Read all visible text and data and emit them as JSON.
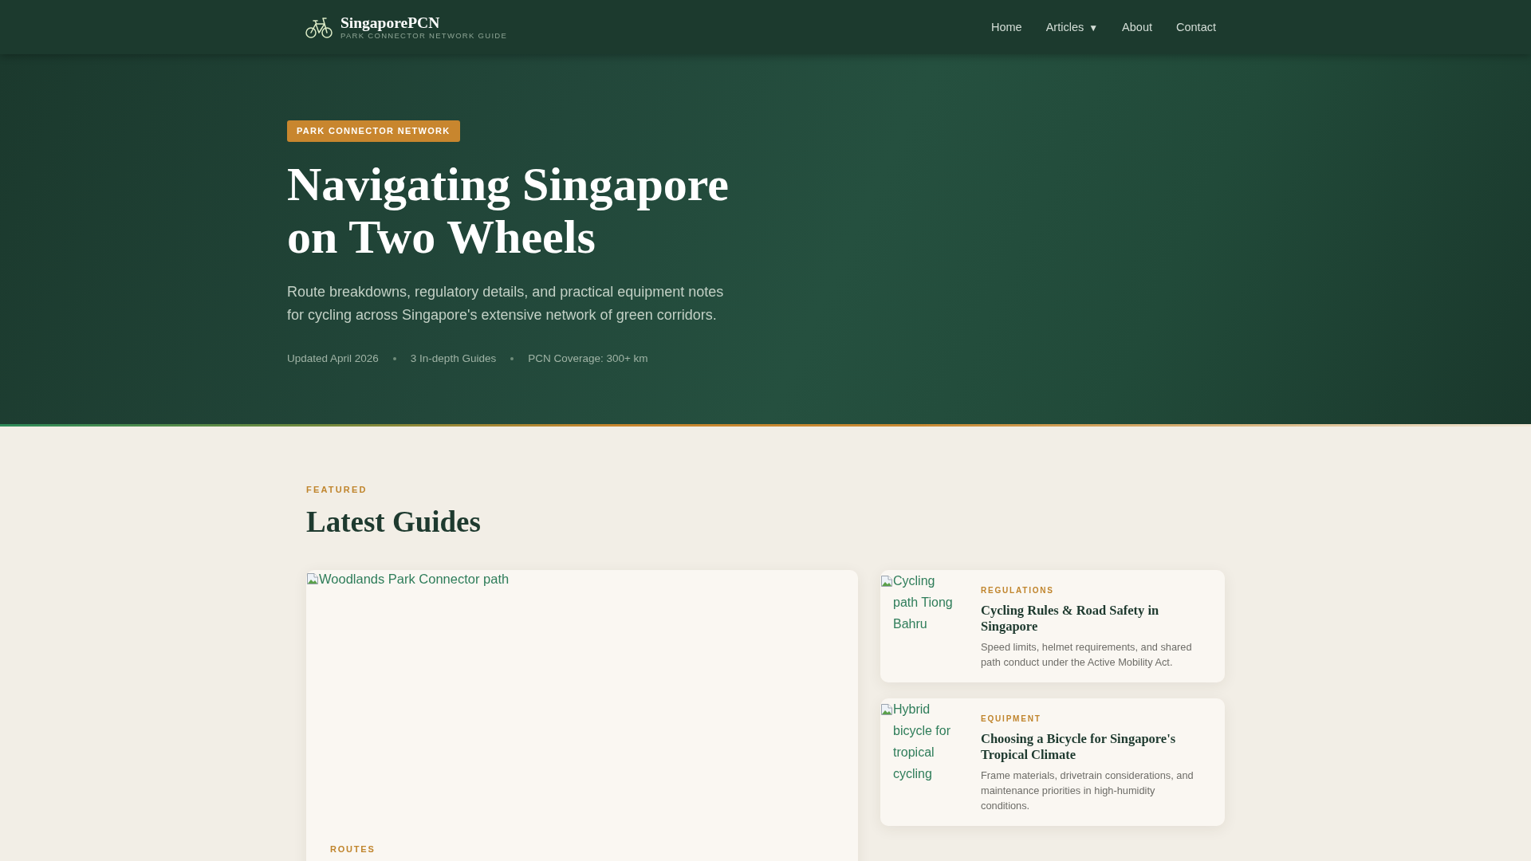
{
  "nav": {
    "logo_title": "SingaporePCN",
    "logo_subtitle": "PARK CONNECTOR NETWORK GUIDE",
    "links": [
      {
        "label": "Home"
      },
      {
        "label": "Articles",
        "caret": "▼"
      },
      {
        "label": "About"
      },
      {
        "label": "Contact"
      }
    ]
  },
  "hero": {
    "badge": "PARK CONNECTOR NETWORK",
    "title": "Navigating Singapore on Two Wheels",
    "lead": "Route breakdowns, regulatory details, and practical equipment notes for cycling across Singapore's extensive network of green corridors.",
    "meta": [
      "Updated April 2026",
      "3 In-depth Guides",
      "PCN Coverage: 300+ km"
    ]
  },
  "featured": {
    "eyebrow": "FEATURED",
    "heading": "Latest Guides",
    "main_card": {
      "image_alt": "Woodlands Park Connector path",
      "category": "ROUTES"
    },
    "cards": [
      {
        "image_alt": "Cycling path Tiong Bahru",
        "category": "REGULATIONS",
        "title": "Cycling Rules & Road Safety in Singapore",
        "description": "Speed limits, helmet requirements, and shared path conduct under the Active Mobility Act."
      },
      {
        "image_alt": "Hybrid bicycle for tropical cycling",
        "category": "EQUIPMENT",
        "title": "Choosing a Bicycle for Singapore's Tropical Climate",
        "description": "Frame materials, drivetrain considerations, and maintenance priorities in high-humidity conditions."
      }
    ]
  }
}
